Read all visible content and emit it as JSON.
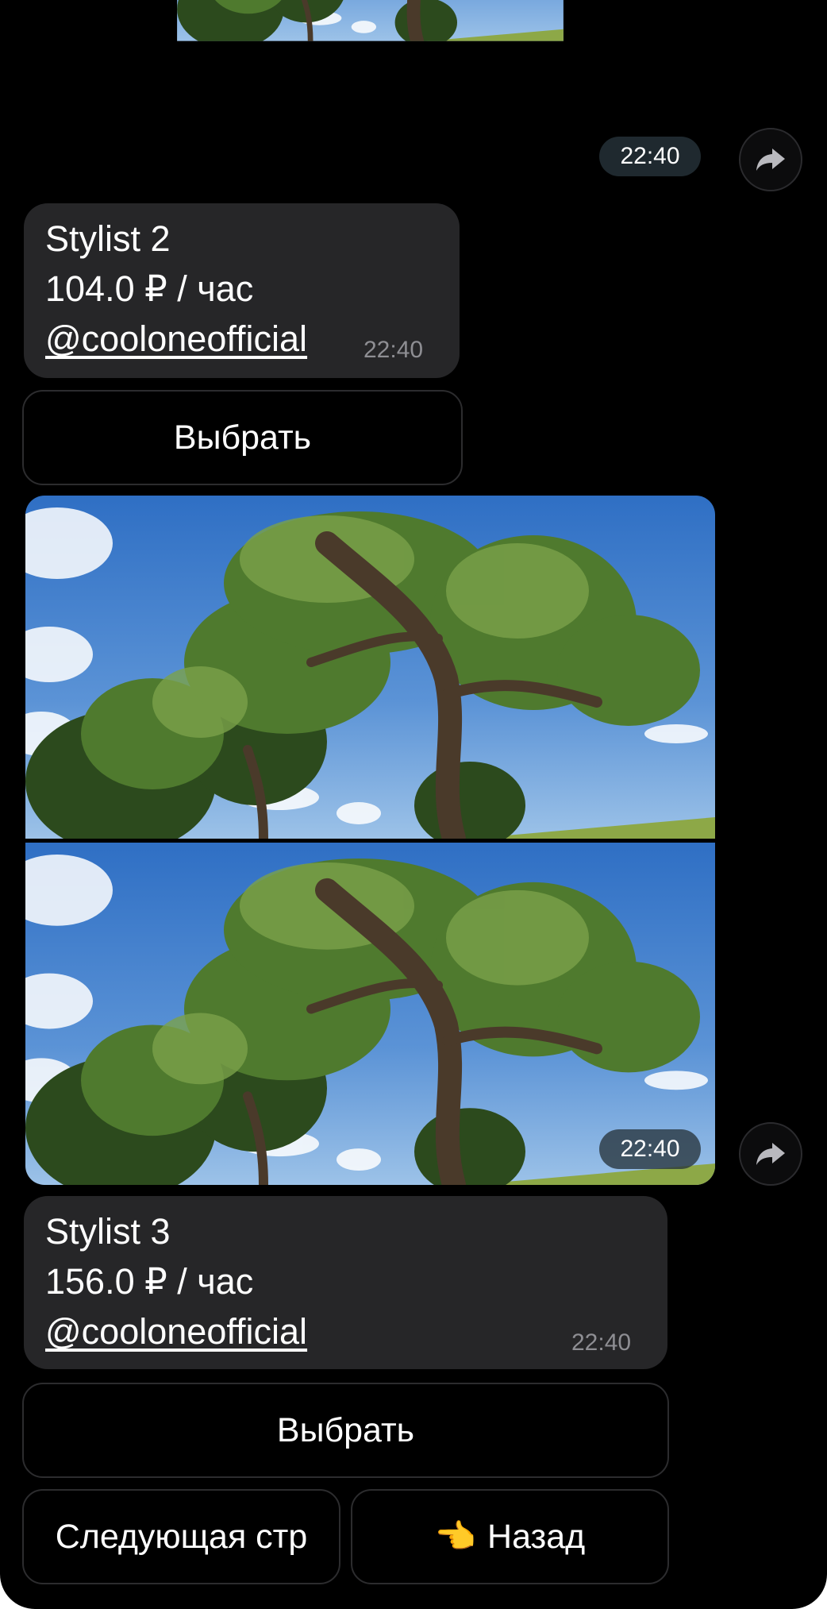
{
  "messages": [
    {
      "photo_time": "22:40",
      "name": "Stylist 2",
      "price": "104.0 ₽ / час",
      "username": "@cooloneofficial",
      "time": "22:40",
      "select_button": "Выбрать"
    },
    {
      "photo_time": "22:40",
      "name": "Stylist 3",
      "price": "156.0 ₽ / час",
      "username": "@cooloneofficial",
      "time": "22:40",
      "select_button": "Выбрать"
    }
  ],
  "keyboard": {
    "next_page": "Следующая стр",
    "back_emoji": "👈",
    "back": "Назад"
  },
  "icons": {
    "share": "share-arrow-icon"
  },
  "colors": {
    "background": "#000000",
    "bubble": "#262628",
    "button_border": "#2c2c2e",
    "time_pill": "#28343c"
  }
}
